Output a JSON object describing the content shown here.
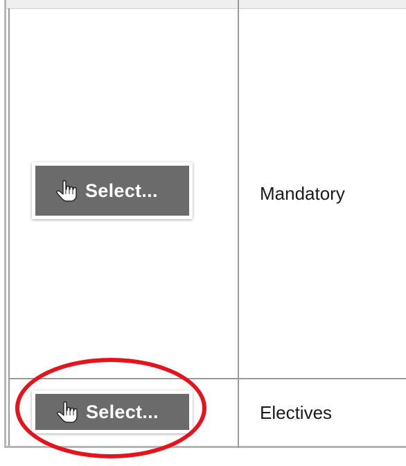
{
  "table": {
    "rows": [
      {
        "button_label": "Select...",
        "type": "Mandatory"
      },
      {
        "button_label": "Select...",
        "type": "Electives"
      }
    ]
  },
  "icons": {
    "select": "hand-pointer-icon"
  },
  "colors": {
    "button_face": "#6b6b6b",
    "grid_line": "#9a9a9a",
    "highlight_ring": "#e5141c"
  }
}
